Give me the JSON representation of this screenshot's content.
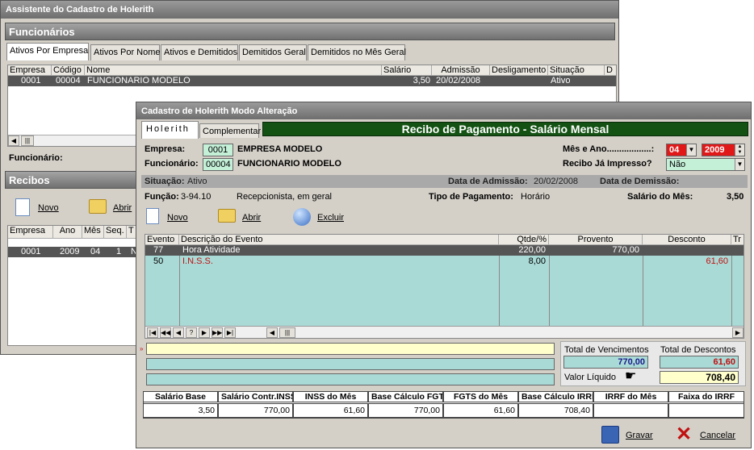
{
  "back_window": {
    "title": "Assistente do Cadastro de Holerith",
    "funcionarios_header": "Funcionários",
    "tabs": [
      "Ativos Por Empresa",
      "Ativos Por Nome",
      "Ativos e Demitidos",
      "Demitidos Geral",
      "Demitidos no Mês Geral"
    ],
    "grid": {
      "columns": [
        "Empresa",
        "Código",
        "Nome",
        "Salário",
        "Admissão",
        "Desligamento",
        "Situação",
        "D"
      ],
      "rows": [
        {
          "empresa": "0001",
          "codigo": "00004",
          "nome": "FUNCIONARIO MODELO",
          "salario": "3,50",
          "admissao": "20/02/2008",
          "desligamento": "",
          "situacao": "Ativo"
        }
      ]
    },
    "funcionario_label": "Funcionário:",
    "recibos_header": "Recibos",
    "toolbar": {
      "novo": "Novo",
      "abrir": "Abrir"
    },
    "recibos_grid": {
      "columns": [
        "Empresa",
        "Ano",
        "Mês",
        "Seq.",
        "T"
      ],
      "rows": [
        {
          "empresa": "0001",
          "ano": "2009",
          "mes": "04",
          "seq": "1",
          "t": "N"
        }
      ]
    }
  },
  "front_window": {
    "title": "Cadastro de Holerith Modo Alteração",
    "tabs": [
      "Holerith",
      "Complementar"
    ],
    "banner": "Recibo de Pagamento - Salário Mensal",
    "empresa_label": "Empresa:",
    "empresa_code": "0001",
    "empresa_name": "EMPRESA MODELO",
    "funcionario_label": "Funcionário:",
    "funcionario_code": "00004",
    "funcionario_name": "FUNCIONARIO MODELO",
    "mes_ano_label": "Mês e Ano..................:",
    "mes": "04",
    "ano": "2009",
    "impresso_label": "Recibo Já Impresso?",
    "impresso_value": "Não",
    "situacao_label": "Situação:",
    "situacao_value": "Ativo",
    "admissao_label": "Data de Admissão:",
    "admissao_value": "20/02/2008",
    "demissao_label": "Data de Demissão:",
    "funcao_label": "Função:",
    "funcao_value": "3-94.10",
    "funcao_desc": "Recepcionista, em geral",
    "tipo_pag_label": "Tipo de Pagamento:",
    "tipo_pag_value": "Horário",
    "salario_mes_label": "Salário do Mês:",
    "salario_mes_value": "3,50",
    "toolbar": {
      "novo": "Novo",
      "abrir": "Abrir",
      "excluir": "Excluir"
    },
    "events_grid": {
      "columns": [
        "Evento",
        "Descrição do Evento",
        "Qtde/%",
        "Provento",
        "Desconto",
        "Tr"
      ],
      "rows": [
        {
          "evento": "77",
          "descricao": "Hora Atividade",
          "qtde": "220,00",
          "provento": "770,00",
          "desconto": ""
        },
        {
          "evento": "50",
          "descricao": "I.N.S.S.",
          "qtde": "8,00",
          "provento": "",
          "desconto": "61,60"
        }
      ]
    },
    "nav_buttons": [
      "|◀",
      "◀◀",
      "◀",
      "?",
      "▶",
      "▶▶",
      "▶|"
    ],
    "total_venc_label": "Total de Vencimentos",
    "total_venc_value": "770,00",
    "total_desc_label": "Total de Descontos",
    "total_desc_value": "61,60",
    "liquido_label": "Valor Líquido",
    "liquido_value": "708,40",
    "summary": {
      "headers": [
        "Salário Base",
        "Salário Contr.INSS",
        "INSS do Mês",
        "Base Cálculo FGTS",
        "FGTS do Mês",
        "Base Cálculo IRRF",
        "IRRF do Mês",
        "Faixa do IRRF"
      ],
      "values": [
        "3,50",
        "770,00",
        "61,60",
        "770,00",
        "61,60",
        "708,40",
        "",
        ""
      ]
    },
    "gravar": "Gravar",
    "cancelar": "Cancelar"
  }
}
